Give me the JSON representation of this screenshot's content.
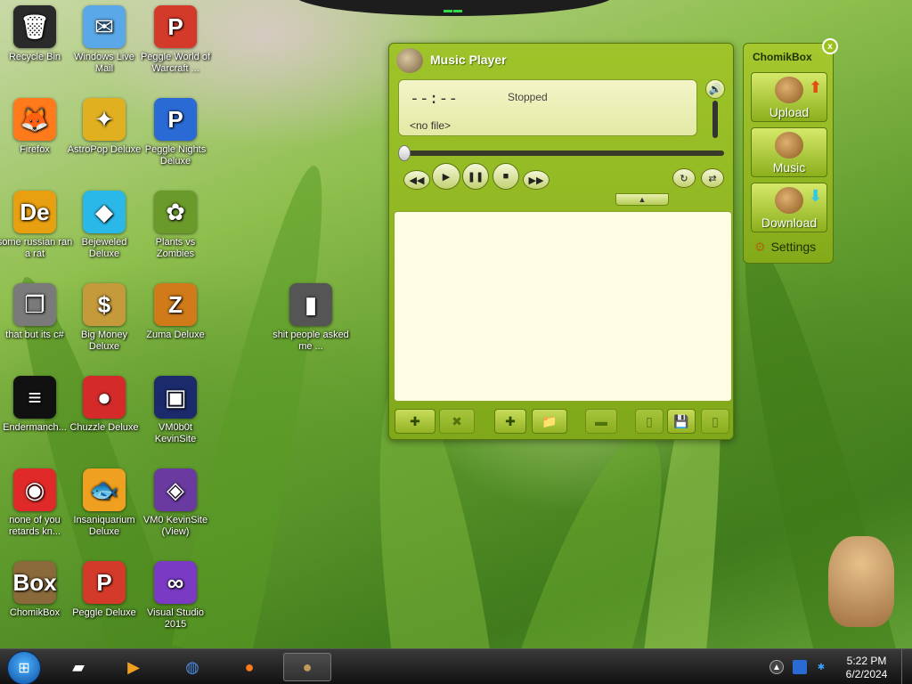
{
  "desktop": {
    "icons": [
      {
        "label": "Recycle Bin",
        "glyph": "🗑",
        "color": "#2a2a2a"
      },
      {
        "label": "Windows Live Mail",
        "glyph": "✉",
        "color": "#5aa8e8"
      },
      {
        "label": "Peggle World of Warcraft ...",
        "glyph": "P",
        "color": "#d43a2a"
      },
      {
        "label": "Firefox",
        "glyph": "🦊",
        "color": "#ff7a1a"
      },
      {
        "label": "AstroPop Deluxe",
        "glyph": "✦",
        "color": "#e0b020"
      },
      {
        "label": "Peggle Nights Deluxe",
        "glyph": "P",
        "color": "#2a6ad4"
      },
      {
        "label": "some russian ran a rat",
        "glyph": "De",
        "color": "#e8a010"
      },
      {
        "label": "Bejeweled Deluxe",
        "glyph": "◆",
        "color": "#2ab8e8"
      },
      {
        "label": "Plants vs Zombies",
        "glyph": "✿",
        "color": "#6a9a2a"
      },
      {
        "label": "that but its c#",
        "glyph": "❐",
        "color": "#7a7a7a"
      },
      {
        "label": "Big Money Deluxe",
        "glyph": "$",
        "color": "#c49a3a"
      },
      {
        "label": "Zuma Deluxe",
        "glyph": "Z",
        "color": "#d07a1a"
      },
      {
        "label": "shit people asked me ...",
        "glyph": "▮",
        "color": "#555"
      },
      {
        "label": "Endermanch...",
        "glyph": "≡",
        "color": "#111"
      },
      {
        "label": "Chuzzle Deluxe",
        "glyph": "●",
        "color": "#d42a2a"
      },
      {
        "label": "VM0b0t KevinSite",
        "glyph": "▣",
        "color": "#1a2a6a"
      },
      {
        "label": "none of you retards kn...",
        "glyph": "◉",
        "color": "#e02a2a"
      },
      {
        "label": "Insaniquarium Deluxe",
        "glyph": "🐟",
        "color": "#f0a020"
      },
      {
        "label": "VM0 KevinSite (View)",
        "glyph": "◈",
        "color": "#6a3aa0"
      },
      {
        "label": "ChomikBox",
        "glyph": "Box",
        "color": "#8a6a3a"
      },
      {
        "label": "Peggle Deluxe",
        "glyph": "P",
        "color": "#d43a2a"
      },
      {
        "label": "Visual Studio 2015",
        "glyph": "∞",
        "color": "#7a3ac4"
      }
    ]
  },
  "player": {
    "title": "Music Player",
    "time": "--:--",
    "status": "Stopped",
    "file": "<no file>",
    "collapse": "▲"
  },
  "chomikbox": {
    "title": "ChomikBox",
    "close": "x",
    "upload": "Upload",
    "music": "Music",
    "download": "Download",
    "settings": "Settings"
  },
  "taskbar": {
    "time": "5:22 PM",
    "date": "6/2/2024"
  }
}
